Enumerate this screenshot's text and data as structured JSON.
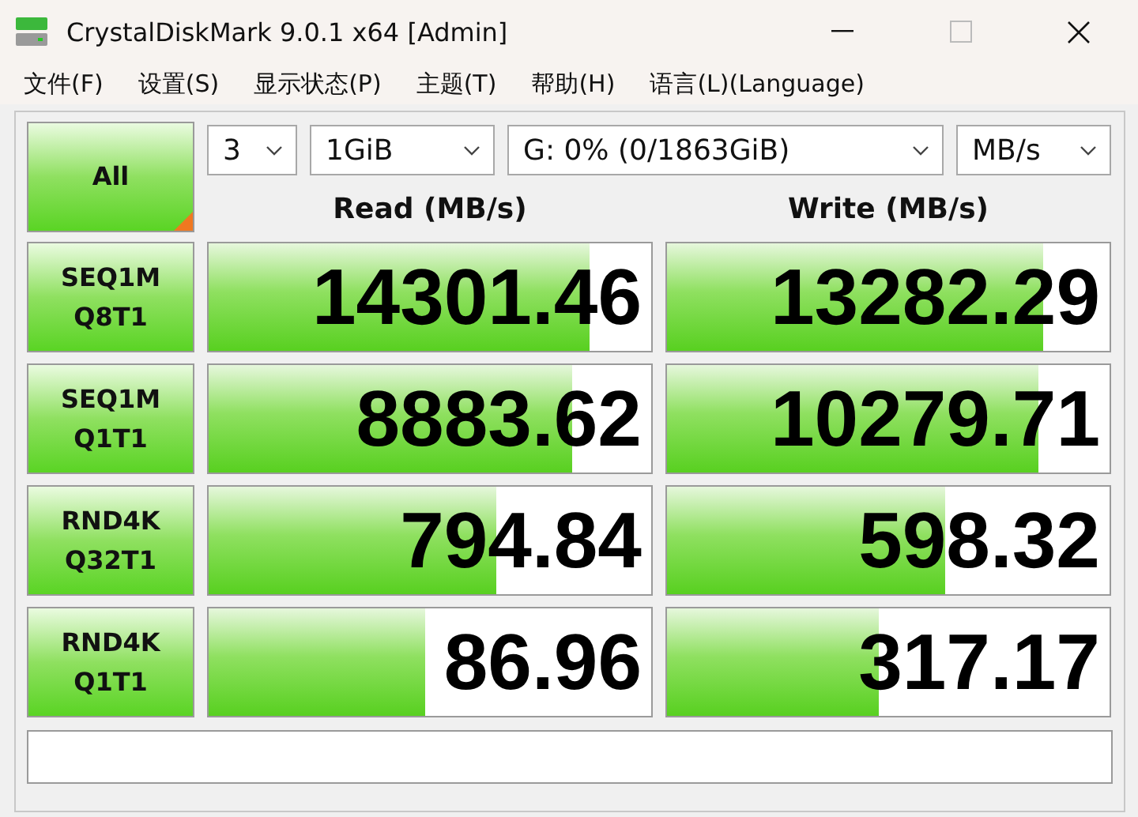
{
  "window": {
    "title": "CrystalDiskMark 9.0.1 x64 [Admin]"
  },
  "menu": [
    "文件(F)",
    "设置(S)",
    "显示状态(P)",
    "主题(T)",
    "帮助(H)",
    "语言(L)(Language)"
  ],
  "all_button": "All",
  "selectors": [
    {
      "value": "3"
    },
    {
      "value": "1GiB"
    },
    {
      "value": "G: 0% (0/1863GiB)"
    },
    {
      "value": "MB/s"
    }
  ],
  "columns": [
    "Read (MB/s)",
    "Write (MB/s)"
  ],
  "tests": [
    {
      "name": "SEQ1M",
      "params": "Q8T1",
      "read": {
        "value": "14301.46",
        "level": 0.86
      },
      "write": {
        "value": "13282.29",
        "level": 0.85
      }
    },
    {
      "name": "SEQ1M",
      "params": "Q1T1",
      "read": {
        "value": "8883.62",
        "level": 0.82
      },
      "write": {
        "value": "10279.71",
        "level": 0.84
      }
    },
    {
      "name": "RND4K",
      "params": "Q32T1",
      "read": {
        "value": "794.84",
        "level": 0.65
      },
      "write": {
        "value": "598.32",
        "level": 0.63
      }
    },
    {
      "name": "RND4K",
      "params": "Q1T1",
      "read": {
        "value": "86.96",
        "level": 0.49
      },
      "write": {
        "value": "317.17",
        "level": 0.48
      }
    }
  ]
}
